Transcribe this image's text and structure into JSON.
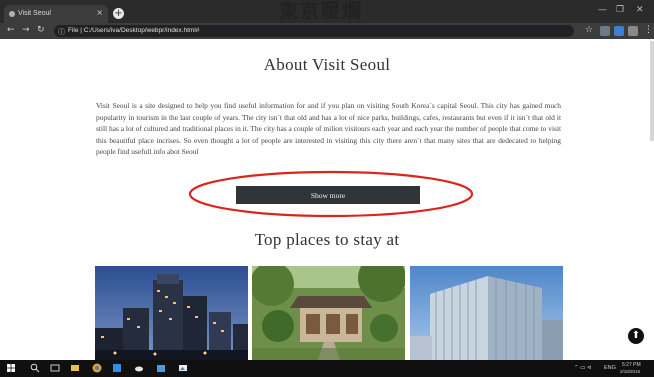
{
  "browser": {
    "tab_title": "Visit Seoul",
    "tab_close": "×",
    "new_tab": "+",
    "url": "File | C:/Users/iva/Desktop/webpr/index.html#",
    "nav": {
      "back": "←",
      "forward": "→",
      "reload": "↻"
    },
    "window_controls": [
      "—",
      "❐",
      "✕"
    ]
  },
  "header": {
    "logo_text": "東京暖爛"
  },
  "about": {
    "title": "About Visit Seoul",
    "body": "Visit Seoul is a site designed to help you find useful information for and if you plan on visiting South Korea`s capital Seoul. This city has gained much popularity in tourism in the last couple of years. The city isn`t that old and has a lot of nice parks, buildings, cafes, restaurants but even if it isn`t that old it still has a lot of cultured and traditional places in it. The city has a couple of milion visitours each year and each year the number of people that come to visit this beautiful place incrises. So even thought a lot of people are interested in visiting this city there aren`t that many sites that are dedecated to helping people find usefull info abot Seoul",
    "button_label": "Show more"
  },
  "places": {
    "title": "Top places to stay at",
    "photos": [
      {
        "icon": "hotel-skyline-photo"
      },
      {
        "icon": "traditional-guesthouse-photo"
      },
      {
        "icon": "glass-tower-photo"
      }
    ]
  },
  "colors": {
    "annotation_red": "#d9261c",
    "button_bg": "#2f3439",
    "chrome_dark": "#2b2b2b"
  },
  "taskbar": {
    "tray_time": "5:27 PM",
    "tray_date": "2/18/2018",
    "tray_lang": "ENG"
  }
}
